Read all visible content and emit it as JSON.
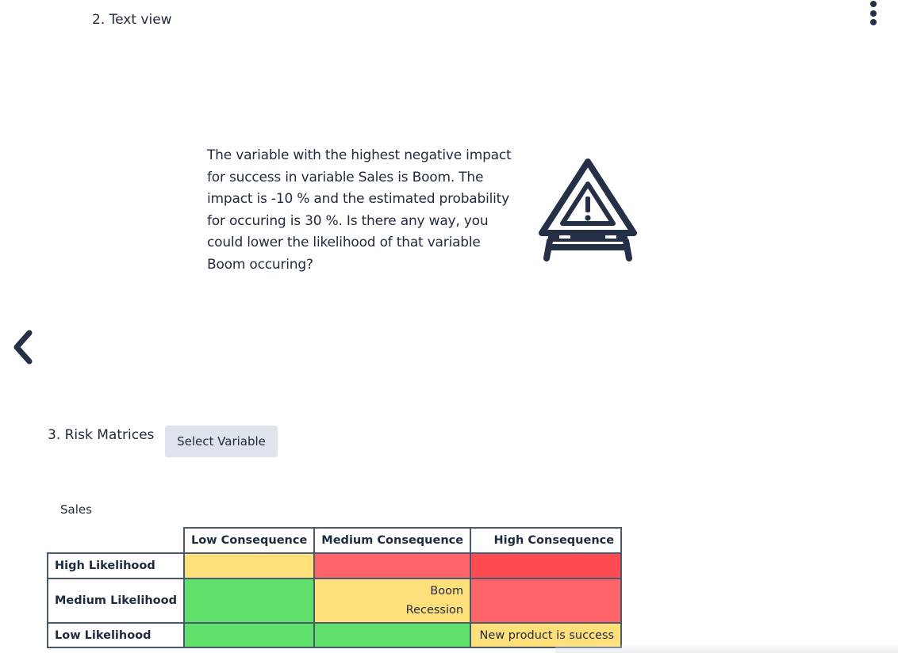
{
  "text_view": {
    "title": "2. Text view",
    "message": "The variable with the highest negative impact for success in variable Sales is Boom. The impact is -10 % and the estimated probability for occuring is 30 %. Is there any way, you could lower the likelihood of that variable Boom occuring?",
    "icon": "warning-triangle-icon"
  },
  "nav": {
    "back_icon": "chevron-left-icon",
    "menu_icon": "more-vertical-icon"
  },
  "risk_matrices": {
    "title": "3. Risk Matrices",
    "select_button_label": "Select Variable",
    "matrix": {
      "caption": "Sales",
      "columns": [
        "Low Consequence",
        "Medium Consequence",
        "High Consequence"
      ],
      "rows": [
        {
          "label": "High Likelihood",
          "cells": [
            {
              "color": "#ffe07a",
              "items": []
            },
            {
              "color": "#ff6469",
              "items": []
            },
            {
              "color": "#ff4b52",
              "items": []
            }
          ]
        },
        {
          "label": "Medium Likelihood",
          "cells": [
            {
              "color": "#5fe06a",
              "items": []
            },
            {
              "color": "#ffe07a",
              "items": [
                "Boom",
                "Recession"
              ]
            },
            {
              "color": "#ff6469",
              "items": []
            }
          ]
        },
        {
          "label": "Low Likelihood",
          "cells": [
            {
              "color": "#5fe06a",
              "items": []
            },
            {
              "color": "#5fe06a",
              "items": []
            },
            {
              "color": "#ffe07a",
              "items": [
                "New product is success"
              ]
            }
          ]
        }
      ]
    }
  }
}
